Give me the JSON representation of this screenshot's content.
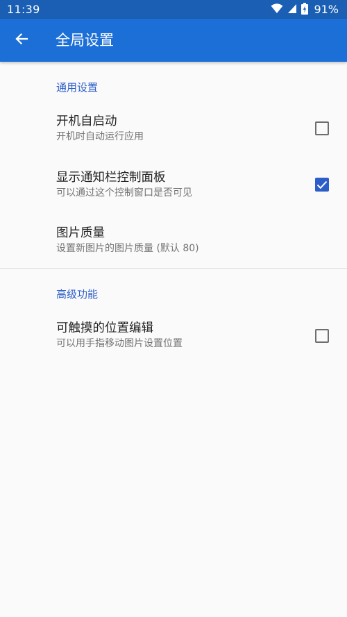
{
  "status_bar": {
    "time": "11:39",
    "battery_percent": "91%",
    "icons": [
      "wifi-icon",
      "signal-icon",
      "battery-icon"
    ]
  },
  "app_bar": {
    "title": "全局设置",
    "back_icon": "arrow-back-icon"
  },
  "sections": [
    {
      "header": "通用设置",
      "items": [
        {
          "title": "开机自启动",
          "summary": "开机时自动运行应用",
          "checkbox": "unchecked"
        },
        {
          "title": "显示通知栏控制面板",
          "summary": "可以通过这个控制窗口是否可见",
          "checkbox": "checked"
        },
        {
          "title": "图片质量",
          "summary": "设置新图片的图片质量 (默认 80)",
          "checkbox": null
        }
      ]
    },
    {
      "header": "高级功能",
      "items": [
        {
          "title": "可触摸的位置编辑",
          "summary": "可以用手指移动图片设置位置",
          "checkbox": "unchecked"
        }
      ]
    }
  ],
  "colors": {
    "status_bar": "#1a5fb4",
    "app_bar": "#1c6fd6",
    "accent": "#2d5ec8",
    "background": "#fafafa"
  }
}
